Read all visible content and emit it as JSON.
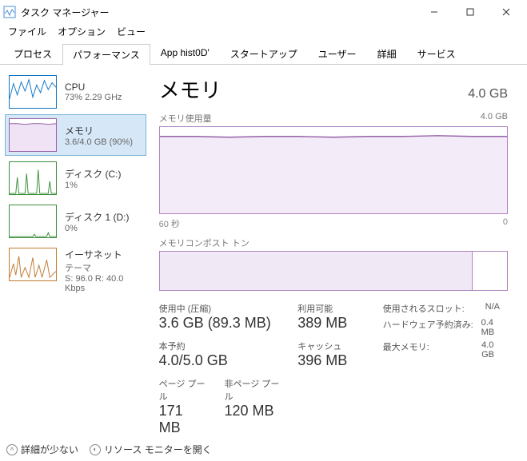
{
  "window": {
    "title": "タスク マネージャー"
  },
  "menu": {
    "file": "ファイル",
    "options": "オプション",
    "view": "ビュー"
  },
  "tabs": {
    "processes": "プロセス",
    "performance": "パフォーマンス",
    "apphistory": "App hist0D'",
    "startup": "スタートアップ",
    "users": "ユーザー",
    "details": "詳細",
    "services": "サービス"
  },
  "sidebar": {
    "cpu": {
      "name": "CPU",
      "value": "73%  2.29 GHz"
    },
    "memory": {
      "name": "メモリ",
      "value": "3.6/4.0 GB (90%)"
    },
    "disk0": {
      "name": "ディスク (C:)",
      "value": "1%"
    },
    "disk1": {
      "name": "ディスク 1 (D:)",
      "value": "0%"
    },
    "eth": {
      "name": "イーサネット",
      "line2": "テーマ",
      "value": "S: 96.0  R: 40.0 Kbps"
    }
  },
  "main": {
    "title": "メモリ",
    "total": "4.0 GB",
    "usage_label": "メモリ使用量",
    "usage_max": "4.0 GB",
    "axis_left": "60 秒",
    "axis_right": "0",
    "comp_label": "メモリコンポスト トン"
  },
  "stats": {
    "in_use_label": "使用中 (圧縮)",
    "in_use_value": "3.6 GB (89.3 MB)",
    "avail_label": "利用可能",
    "avail_value": "389 MB",
    "committed_label": "本予約",
    "committed_value": "4.0/5.0 GB",
    "cached_label": "キャッシュ",
    "cached_value": "396 MB",
    "paged_label": "ページ プール",
    "paged_value": "171 MB",
    "nonpaged_label": "非ページ プール",
    "nonpaged_value": "120 MB"
  },
  "right": {
    "slots_label": "使用されるスロット:",
    "slots_value": "N/A",
    "hw_label": "ハードウェア予約済み:",
    "hw_value": "0.4 MB",
    "max_label": "最大メモリ:",
    "max_value": "4.0 GB"
  },
  "footer": {
    "less": "詳細が少ない",
    "resmon": "リソース モニターを開く"
  },
  "chart_data": {
    "type": "area",
    "title": "メモリ使用量",
    "ylabel": "GB",
    "ylim": [
      0,
      4.0
    ],
    "xlim_seconds": [
      60,
      0
    ],
    "series": [
      {
        "name": "メモリ使用量",
        "values_gb": [
          3.6,
          3.6,
          3.6,
          3.6,
          3.6,
          3.6,
          3.6,
          3.6,
          3.6,
          3.6,
          3.6,
          3.6,
          3.6,
          3.6,
          3.6,
          3.6,
          3.6,
          3.6,
          3.6,
          3.6
        ]
      }
    ],
    "composition_bar": {
      "type": "bar",
      "total_gb": 4.0,
      "in_use_gb": 3.6,
      "fraction": 0.9
    }
  }
}
